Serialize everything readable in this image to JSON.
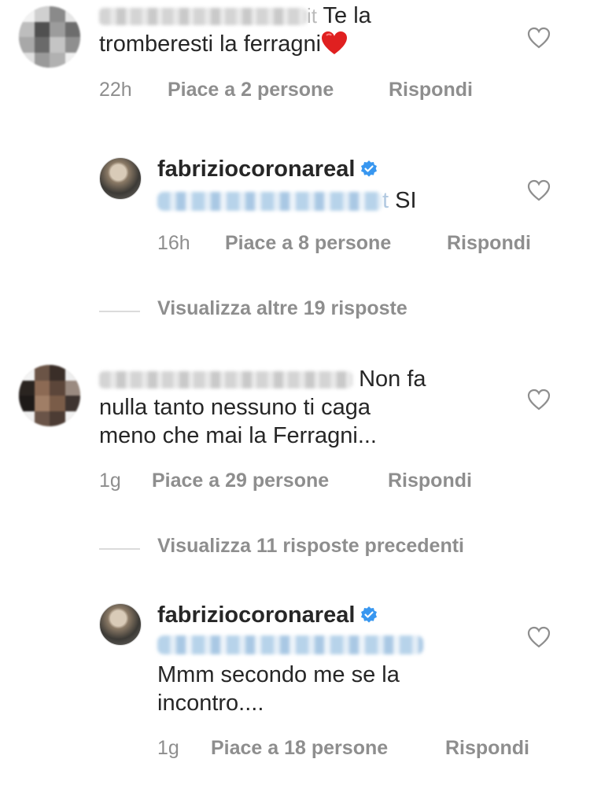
{
  "comments": [
    {
      "text_end": "Te la",
      "text_line2": "tromberesti la ferragni",
      "emoji": "❤️",
      "time": "22h",
      "likes": "Piace a 2 persone",
      "reply": "Rispondi",
      "username_suffix": "it"
    },
    {
      "username": "fabriziocoronareal",
      "mention_suffix": "t",
      "text": "SI",
      "time": "16h",
      "likes": "Piace a 8 persone",
      "reply": "Rispondi"
    },
    {
      "text_end": "Non fa",
      "text_line2": "nulla tanto nessuno ti caga",
      "text_line3": "meno che mai la Ferragni...",
      "time": "1g",
      "likes": "Piace a 29 persone",
      "reply": "Rispondi"
    },
    {
      "username": "fabriziocoronareal",
      "text_line1": "Mmm secondo me se la",
      "text_line2": "incontro....",
      "time": "1g",
      "likes": "Piace a 18 persone",
      "reply": "Rispondi"
    }
  ],
  "view_replies_1": "Visualizza altre 19 risposte",
  "view_replies_2": "Visualizza 11 risposte precedenti",
  "colors": {
    "verified": "#3897f0",
    "heart_emoji": "#e02020",
    "meta_gray": "#8e8e8e"
  }
}
